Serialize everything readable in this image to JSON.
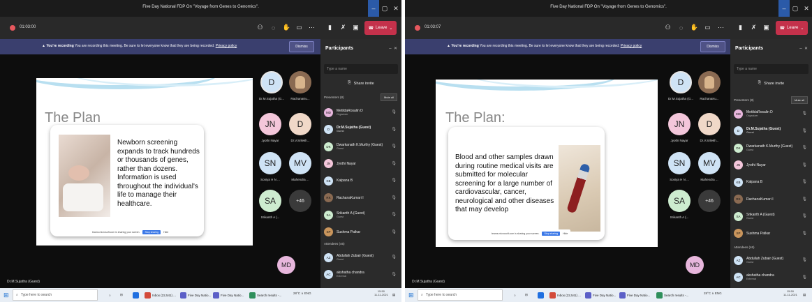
{
  "left": {
    "title": "Five Day National FDP On \"Voyage from Genes to Genomics\".",
    "timer": "01:03:00",
    "leave_label": "Leave",
    "banner": {
      "bold": "You're recording",
      "text": "You are recording this meeting. Be sure to let everyone know that they are being recorded.",
      "link": "Privacy policy",
      "dismiss": "Dismiss"
    },
    "slide": {
      "title": "The Plan",
      "body": "Newborn screening expands to track hundreds or thousands of genes, rather than dozens. Information is used throughout the individual's life to manage their healthcare.",
      "share_text": "teams.microsoft.com is sharing your screen.",
      "stop_label": "Stop sharing",
      "hide_label": "Hide"
    },
    "tiles": [
      {
        "initials": "D",
        "name": "Dr.M.Sujatha (G...",
        "color": "#cfe3f5"
      },
      {
        "initials": "",
        "name": "RachanaKu...",
        "color": "#8a6a52"
      },
      {
        "initials": "JN",
        "name": "Jyothi Nayar",
        "color": "#f3c6da"
      },
      {
        "initials": "D",
        "name": "Dr.V.Srilekh...",
        "color": "#f0d8c8"
      },
      {
        "initials": "SN",
        "name": "Soniya H N ...",
        "color": "#cfe3f5"
      },
      {
        "initials": "MV",
        "name": "Mahendra ...",
        "color": "#cfe3f5"
      },
      {
        "initials": "SA",
        "name": "Srikanth A (...",
        "color": "#cdeccf"
      },
      {
        "initials": "+46",
        "name": "",
        "color": "#3a3a3a"
      }
    ],
    "md_initials": "MD",
    "presenter_tag": "Dr.M.Sujatha (Guest)",
    "panel": {
      "title": "Participants",
      "search_placeholder": "Type a name",
      "share_invite": "Share invite",
      "presenters_label": "Presenters (8)",
      "mute_all": "Mute all",
      "presenters": [
        {
          "initials": "MD",
          "name": "MetildaRosalin D",
          "role": "Organizer",
          "color": "#e7b6dc",
          "bold": false
        },
        {
          "initials": "D",
          "name": "Dr.M.Sujatha (Guest)",
          "role": "Guest",
          "color": "#cfe3f5",
          "bold": true
        },
        {
          "initials": "DK",
          "name": "Dwarkanath K.Murthy (Guest)",
          "role": "Guest",
          "color": "#cdeccf",
          "bold": false
        },
        {
          "initials": "JN",
          "name": "Jyothi Nayar",
          "role": "",
          "color": "#f3c6da",
          "bold": false
        },
        {
          "initials": "KB",
          "name": "Kalpana B",
          "role": "",
          "color": "#cfe3f5",
          "bold": false
        },
        {
          "initials": "RK",
          "name": "RachanaKumari I",
          "role": "",
          "color": "#8a6a52",
          "bold": false
        },
        {
          "initials": "SA",
          "name": "Srikanth A (Guest)",
          "role": "Guest",
          "color": "#cdeccf",
          "bold": false
        },
        {
          "initials": "SP",
          "name": "Sushma Patkar",
          "role": "",
          "color": "#c9955c",
          "bold": false
        }
      ],
      "attendees_label": "Attendees (46)",
      "attendees": [
        {
          "initials": "AZ",
          "name": "Abdullah Zubair (Guest)",
          "role": "Guest",
          "color": "#cfe3f5"
        },
        {
          "initials": "AC",
          "name": "akshatha chandra",
          "role": "External",
          "color": "#cfe3f5"
        }
      ]
    },
    "taskbar": {
      "search": "Type here to search",
      "apps": [
        "Inbox (22,541) ...",
        "Five Day Natio...",
        "Five Day Natio...",
        "Search results -..."
      ],
      "tray": "28°C  ∧  ENG",
      "time": "15:50",
      "date": "11-11-2021"
    }
  },
  "right": {
    "title": "Five Day National FDP On \"Voyage from Genes to Genomics\".",
    "timer": "01:03:07",
    "leave_label": "Leave",
    "banner": {
      "bold": "You're recording",
      "text": "You are recording this meeting. Be sure to let everyone know that they are being recorded.",
      "link": "Privacy policy",
      "dismiss": "Dismiss"
    },
    "slide": {
      "title": "The Plan:",
      "body": "Blood and other samples drawn during routine medical visits are submitted for molecular screening for a large number of cardiovascular, cancer, neurological and other diseases that may develop",
      "share_text": "teams.microsoft.com is sharing your screen.",
      "stop_label": "Stop sharing",
      "hide_label": "Hide"
    },
    "tiles": [
      {
        "initials": "D",
        "name": "Dr.M.Sujatha (G...",
        "color": "#cfe3f5"
      },
      {
        "initials": "",
        "name": "RachanaKu...",
        "color": "#8a6a52"
      },
      {
        "initials": "JN",
        "name": "Jyothi Nayar",
        "color": "#f3c6da"
      },
      {
        "initials": "D",
        "name": "Dr.V.Srilekh...",
        "color": "#f0d8c8"
      },
      {
        "initials": "SN",
        "name": "Soniya H N ...",
        "color": "#cfe3f5"
      },
      {
        "initials": "MV",
        "name": "Mahendra ...",
        "color": "#cfe3f5"
      },
      {
        "initials": "SA",
        "name": "Srikanth A (...",
        "color": "#cdeccf"
      },
      {
        "initials": "+46",
        "name": "",
        "color": "#3a3a3a"
      }
    ],
    "md_initials": "MD",
    "presenter_tag": "Dr.M.Sujatha (Guest)",
    "panel": {
      "title": "Participants",
      "search_placeholder": "Type a name",
      "share_invite": "Share invite",
      "presenters_label": "Presenters (8)",
      "mute_all": "Mute all",
      "presenters": [
        {
          "initials": "MD",
          "name": "MetildaRosalin D",
          "role": "Organizer",
          "color": "#e7b6dc",
          "bold": false
        },
        {
          "initials": "D",
          "name": "Dr.M.Sujatha (Guest)",
          "role": "Guest",
          "color": "#cfe3f5",
          "bold": true
        },
        {
          "initials": "DK",
          "name": "Dwarkanath K.Murthy (Guest)",
          "role": "Guest",
          "color": "#cdeccf",
          "bold": false
        },
        {
          "initials": "JN",
          "name": "Jyothi Nayar",
          "role": "",
          "color": "#f3c6da",
          "bold": false
        },
        {
          "initials": "KB",
          "name": "Kalpana B",
          "role": "",
          "color": "#cfe3f5",
          "bold": false
        },
        {
          "initials": "RK",
          "name": "RachanaKumari I",
          "role": "",
          "color": "#8a6a52",
          "bold": false
        },
        {
          "initials": "SA",
          "name": "Srikanth A (Guest)",
          "role": "Guest",
          "color": "#cdeccf",
          "bold": false
        },
        {
          "initials": "SP",
          "name": "Sushma Patkar",
          "role": "",
          "color": "#c9955c",
          "bold": false
        }
      ],
      "attendees_label": "Attendees (46)",
      "attendees": [
        {
          "initials": "AZ",
          "name": "Abdullah Zubair (Guest)",
          "role": "Guest",
          "color": "#cfe3f5"
        },
        {
          "initials": "AC",
          "name": "akshatha chandra",
          "role": "External",
          "color": "#cfe3f5"
        }
      ]
    },
    "taskbar": {
      "search": "Type here to search",
      "apps": [
        "Inbox (22,541) ...",
        "Five Day Natio...",
        "Five Day Natio...",
        "Search results -..."
      ],
      "tray": "28°C  ∧  ENG",
      "time": "15:50",
      "date": "11-11-2021"
    }
  }
}
